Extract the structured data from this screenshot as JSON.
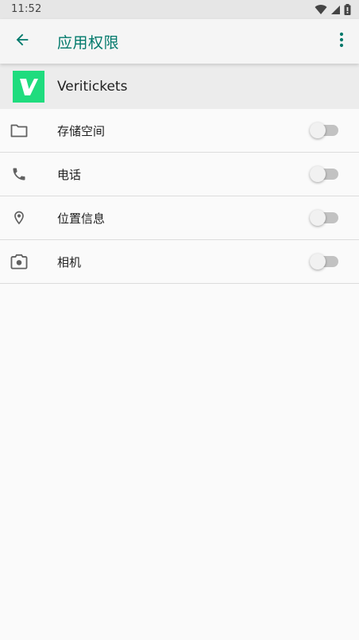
{
  "status_bar": {
    "time": "11:52",
    "icons": [
      "wifi-icon",
      "signal-icon",
      "battery-icon"
    ]
  },
  "app_bar": {
    "title": "应用权限",
    "back_icon": "arrow-back-icon",
    "menu_icon": "more-vert-icon",
    "accent_color": "#00796b"
  },
  "app": {
    "name": "Veritickets",
    "logo_letter": "V",
    "logo_color": "#1fdc7e"
  },
  "permissions": [
    {
      "label": "存储空间",
      "icon": "folder-icon",
      "enabled": false
    },
    {
      "label": "电话",
      "icon": "phone-icon",
      "enabled": false
    },
    {
      "label": "位置信息",
      "icon": "location-pin-icon",
      "enabled": false
    },
    {
      "label": "相机",
      "icon": "camera-icon",
      "enabled": false
    }
  ]
}
